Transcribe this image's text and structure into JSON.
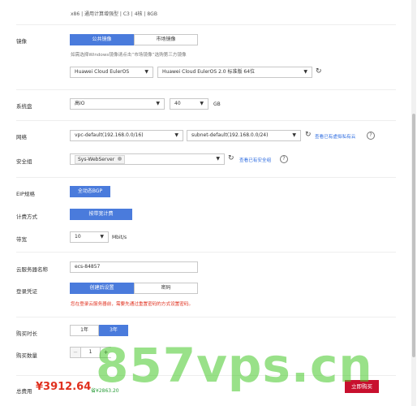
{
  "spec_line": "x86 | 通用计算增强型 | C3 | 4核 | 8GB",
  "image": {
    "label": "镜像",
    "tabs": [
      "公共镜像",
      "市场镜像"
    ],
    "hint": "如需选择Windows镜像请点击“市场镜像”选购第三方镜像",
    "os": "Huawei Cloud EulerOS",
    "version": "Huawei Cloud EulerOS 2.0 标准版 64位"
  },
  "disk": {
    "label": "系统盘",
    "type": "高IO",
    "size": "40",
    "unit": "GB"
  },
  "network": {
    "label": "网络",
    "vpc": "vpc-default(192.168.0.0/16)",
    "subnet": "subnet-default(192.168.0.0/24)",
    "link": "查看已有虚拟私有云"
  },
  "security": {
    "label": "安全组",
    "value": "Sys-WebServer",
    "link": "查看已有安全组"
  },
  "eip": {
    "label": "EIP规格",
    "value": "全动态BGP"
  },
  "billing": {
    "label": "计费方式",
    "value": "按带宽计费"
  },
  "bandwidth": {
    "label": "带宽",
    "value": "10",
    "unit": "Mbit/s"
  },
  "server_name": {
    "label": "云服务器名称",
    "value": "ecs-84857"
  },
  "login": {
    "label": "登录凭证",
    "tabs": [
      "创建后设置",
      "密码"
    ],
    "warning": "您在登录云服务器前，需要先通过重置密码的方式设置密码。"
  },
  "duration": {
    "label": "购买时长",
    "options": [
      "1年",
      "3年"
    ]
  },
  "quantity": {
    "label": "购买数量",
    "minus": "−",
    "value": "1",
    "plus": "+"
  },
  "footer": {
    "total_label": "总费用",
    "price": "¥3912.64",
    "original": "省¥2863.20",
    "buy_button": "立即购买"
  },
  "watermark": "857vps.cn",
  "colors": {
    "primary": "#4a7bdc",
    "link": "#2c6be0",
    "price": "#e0301e",
    "warning": "#e0301e",
    "buy": "#c8102e",
    "watermark": "#46c828"
  }
}
